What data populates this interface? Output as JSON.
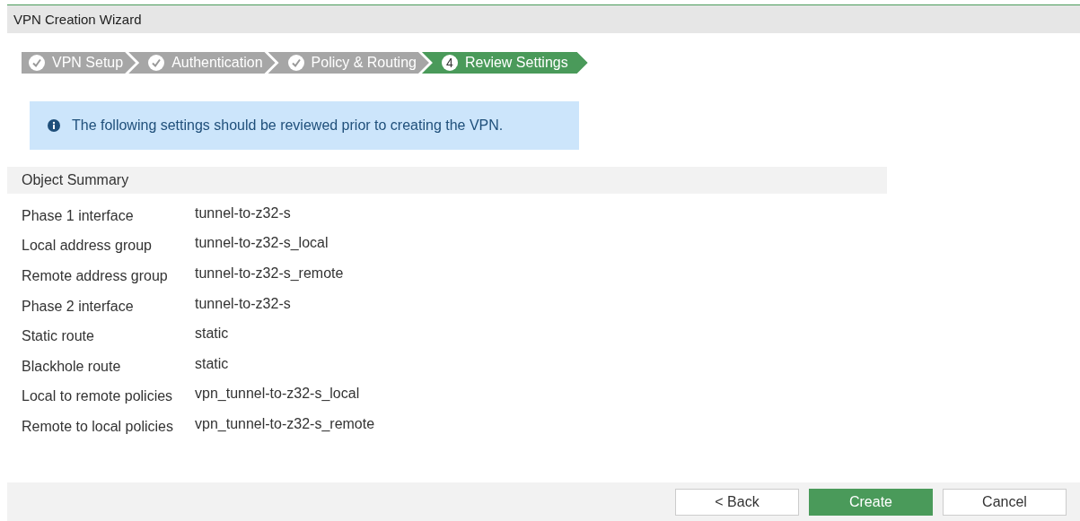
{
  "window": {
    "title": "VPN Creation Wizard"
  },
  "steps": [
    {
      "label": "VPN Setup",
      "done": true,
      "selected": false
    },
    {
      "label": "Authentication",
      "done": true,
      "selected": false
    },
    {
      "label": "Policy & Routing",
      "done": true,
      "selected": false
    },
    {
      "label": "Review Settings",
      "done": false,
      "number": "4",
      "selected": true
    }
  ],
  "info": {
    "message": "The following settings should be reviewed prior to creating the VPN."
  },
  "summary": {
    "title": "Object Summary",
    "rows": [
      {
        "label": "Phase 1 interface",
        "value": "tunnel-to-z32-s"
      },
      {
        "label": "Local address group",
        "value": "tunnel-to-z32-s_local"
      },
      {
        "label": "Remote address group",
        "value": "tunnel-to-z32-s_remote"
      },
      {
        "label": "Phase 2 interface",
        "value": "tunnel-to-z32-s"
      },
      {
        "label": "Static route",
        "value": "static"
      },
      {
        "label": "Blackhole route",
        "value": "static"
      },
      {
        "label": "Local to remote policies",
        "value": "vpn_tunnel-to-z32-s_local"
      },
      {
        "label": "Remote to local policies",
        "value": "vpn_tunnel-to-z32-s_remote"
      }
    ]
  },
  "buttons": [
    {
      "label": "< Back",
      "kind": "secondary"
    },
    {
      "label": "Create",
      "kind": "primary"
    },
    {
      "label": "Cancel",
      "kind": "secondary"
    }
  ]
}
